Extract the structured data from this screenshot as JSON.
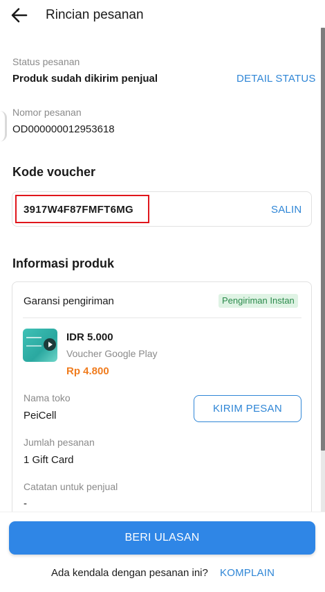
{
  "header": {
    "title": "Rincian pesanan",
    "back_icon": "arrow-left-icon"
  },
  "order_status": {
    "label": "Status pesanan",
    "value": "Produk sudah dikirim penjual",
    "link": "DETAIL STATUS"
  },
  "order_number": {
    "label": "Nomor pesanan",
    "value": "OD000000012953618"
  },
  "voucher": {
    "section_title": "Kode voucher",
    "code": "3917W4F87FMFT6MG",
    "copy_label": "SALIN"
  },
  "product": {
    "section_title": "Informasi produk",
    "guarantee_label": "Garansi pengiriman",
    "badge": "Pengiriman Instan",
    "name": "IDR 5.000",
    "subtitle": "Voucher Google Play",
    "price": "Rp 4.800",
    "store_label": "Nama toko",
    "store_name": "PeiCell",
    "message_button": "KIRIM PESAN",
    "quantity_label": "Jumlah pesanan",
    "quantity_value": "1 Gift Card",
    "note_label": "Catatan untuk penjual",
    "note_value": "-"
  },
  "footer": {
    "review_button": "BERI ULASAN",
    "complaint_question": "Ada kendala dengan pesanan ini?",
    "complaint_link": "KOMPLAIN"
  },
  "colors": {
    "accent": "#2f86d6",
    "primary_button": "#2f86e6",
    "price": "#f07c1e",
    "badge_bg": "#dff3e4",
    "badge_text": "#2a8a4b",
    "highlight": "#e0151b"
  }
}
